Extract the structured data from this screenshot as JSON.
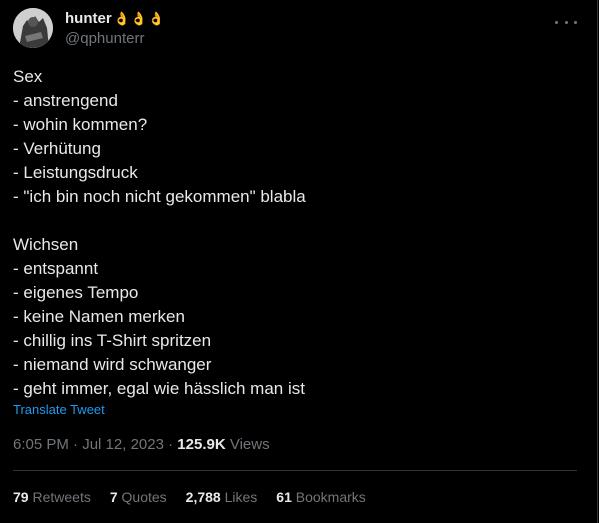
{
  "author": {
    "display_name": "hunter",
    "emoji": "👌👌👌",
    "handle": "@qphunterr"
  },
  "tweet": {
    "lines": [
      "Sex",
      "- anstrengend",
      "- wohin kommen?",
      "- Verhütung",
      "- Leistungsdruck",
      "- \"ich bin noch nicht gekommen\" blabla",
      "",
      "Wichsen",
      "- entspannt",
      "- eigenes Tempo",
      "- keine Namen merken",
      "- chillig ins T-Shirt spritzen",
      "- niemand wird schwanger",
      "- geht immer, egal wie hässlich man ist"
    ],
    "translate_label": "Translate Tweet"
  },
  "meta": {
    "time": "6:05 PM",
    "separator": "·",
    "date": "Jul 12, 2023",
    "views_count": "125.9K",
    "views_label": "Views"
  },
  "stats": {
    "retweets": {
      "count": "79",
      "label": "Retweets"
    },
    "quotes": {
      "count": "7",
      "label": "Quotes"
    },
    "likes": {
      "count": "2,788",
      "label": "Likes"
    },
    "bookmarks": {
      "count": "61",
      "label": "Bookmarks"
    }
  },
  "colors": {
    "background": "#000000",
    "text": "#e7e9ea",
    "muted": "#71767b",
    "link": "#1d9bf0",
    "divider": "#2f3336"
  }
}
